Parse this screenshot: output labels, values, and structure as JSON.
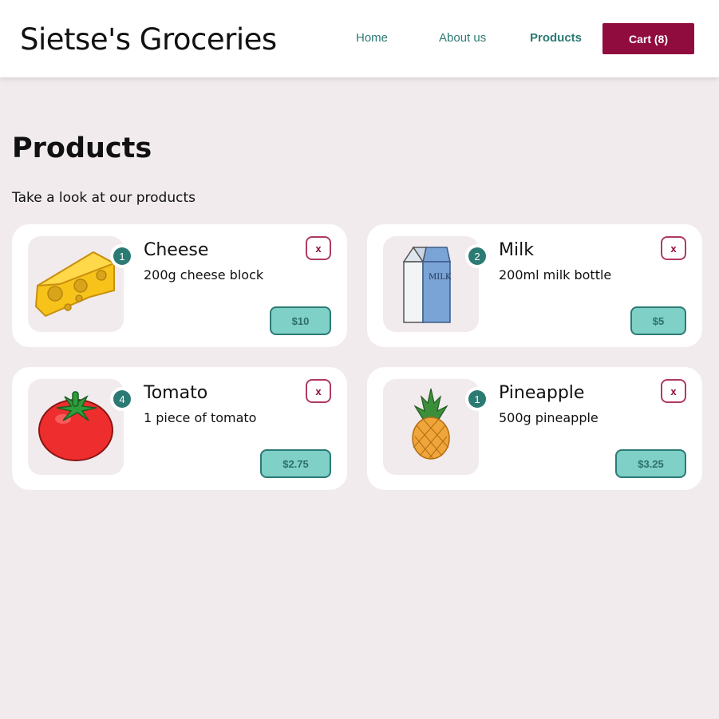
{
  "header": {
    "logo": "Sietse's Groceries",
    "nav": {
      "home": "Home",
      "about": "About us",
      "products": "Products"
    },
    "cart_label": "Cart (8)"
  },
  "main": {
    "title": "Products",
    "subtitle": "Take a look at our products"
  },
  "products": [
    {
      "name": "Cheese",
      "description": "200g cheese block",
      "quantity": "1",
      "price": "$10",
      "remove_label": "x",
      "image": "cheese-image"
    },
    {
      "name": "Milk",
      "description": "200ml milk bottle",
      "quantity": "2",
      "price": "$5",
      "remove_label": "x",
      "image": "milk-carton-image",
      "image_text": "MILK"
    },
    {
      "name": "Tomato",
      "description": "1 piece of tomato",
      "quantity": "4",
      "price": "$2.75",
      "remove_label": "x",
      "image": "tomato-image"
    },
    {
      "name": "Pineapple",
      "description": "500g pineapple",
      "quantity": "1",
      "price": "$3.25",
      "remove_label": "x",
      "image": "pineapple-image"
    }
  ],
  "colors": {
    "accent_teal": "#2c7a74",
    "cart_button": "#900c3f",
    "price_button": "#7fd0c7",
    "page_background": "#f1ebed"
  }
}
